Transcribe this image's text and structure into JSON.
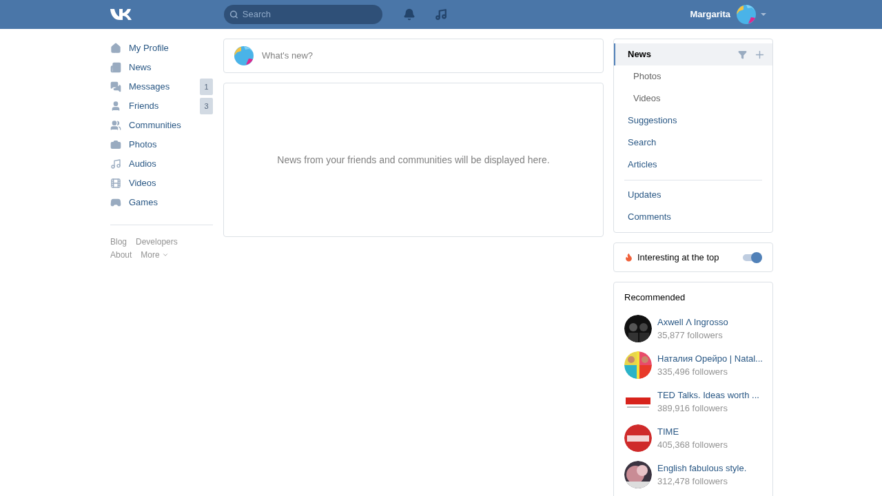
{
  "header": {
    "user_name": "Margarita",
    "search": {
      "placeholder": "Search"
    }
  },
  "sidebar": {
    "items": [
      {
        "label": "My Profile"
      },
      {
        "label": "News"
      },
      {
        "label": "Messages",
        "count": "1"
      },
      {
        "label": "Friends",
        "count": "3"
      },
      {
        "label": "Communities"
      },
      {
        "label": "Photos"
      },
      {
        "label": "Audios"
      },
      {
        "label": "Videos"
      },
      {
        "label": "Games"
      }
    ],
    "footer_links": [
      [
        "Blog",
        "Developers"
      ],
      [
        "About",
        "More"
      ]
    ]
  },
  "composer": {
    "placeholder": "What's new?"
  },
  "feed": {
    "empty_message": "News from your friends and communities will be displayed here."
  },
  "filter_menu": {
    "groups": [
      [
        {
          "label": "News",
          "selected": true,
          "children": [
            {
              "label": "Photos",
              "selected": false
            },
            {
              "label": "Videos",
              "selected": false
            }
          ]
        },
        {
          "label": "Suggestions",
          "selected": false
        },
        {
          "label": "Search",
          "selected": false
        },
        {
          "label": "Articles",
          "selected": false
        }
      ],
      [
        {
          "label": "Updates",
          "selected": false
        },
        {
          "label": "Comments",
          "selected": false
        }
      ]
    ]
  },
  "interesting_toggle": {
    "label": "Interesting at the top",
    "on": true
  },
  "recommended": {
    "title": "Recommended",
    "items": [
      {
        "name": "Axwell Λ Ingrosso",
        "followers": "35,877 followers"
      },
      {
        "name": "Наталия Орейро | Natal...",
        "followers": "335,496 followers"
      },
      {
        "name": "TED Talks. Ideas worth ...",
        "followers": "389,916 followers"
      },
      {
        "name": "TIME",
        "followers": "405,368 followers"
      },
      {
        "name": "English fabulous style.",
        "followers": "312,478 followers"
      }
    ]
  }
}
